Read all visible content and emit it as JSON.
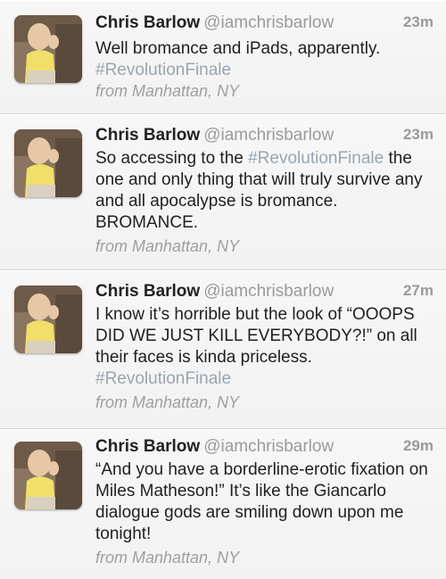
{
  "tweets": [
    {
      "name": "Chris Barlow",
      "handle": "@iamchrisbarlow",
      "time": "23m",
      "text_parts": [
        "Well bromance and iPads, apparently.",
        "#RevolutionFinale"
      ],
      "location": "from Manhattan, NY"
    },
    {
      "name": "Chris Barlow",
      "handle": "@iamchrisbarlow",
      "time": "23m",
      "text_parts": [
        "So accessing to the ",
        "#RevolutionFinale",
        " the one and only thing that will truly survive any and all apocalypse is bromance. BROMANCE."
      ],
      "location": "from Manhattan, NY"
    },
    {
      "name": "Chris Barlow",
      "handle": "@iamchrisbarlow",
      "time": "27m",
      "text_parts": [
        "I know it’s horrible but the look of “OOOPS DID WE JUST KILL EVERYBODY?!” on all their faces is kinda priceless. ",
        "#RevolutionFinale"
      ],
      "location": "from Manhattan, NY"
    },
    {
      "name": "Chris Barlow",
      "handle": "@iamchrisbarlow",
      "time": "29m",
      "text_parts": [
        "“And you have a borderline-erotic fixation on Miles Matheson!” It’s like the Giancarlo dialogue gods are smiling down upon me tonight!"
      ],
      "location": "from Manhattan, NY"
    }
  ]
}
